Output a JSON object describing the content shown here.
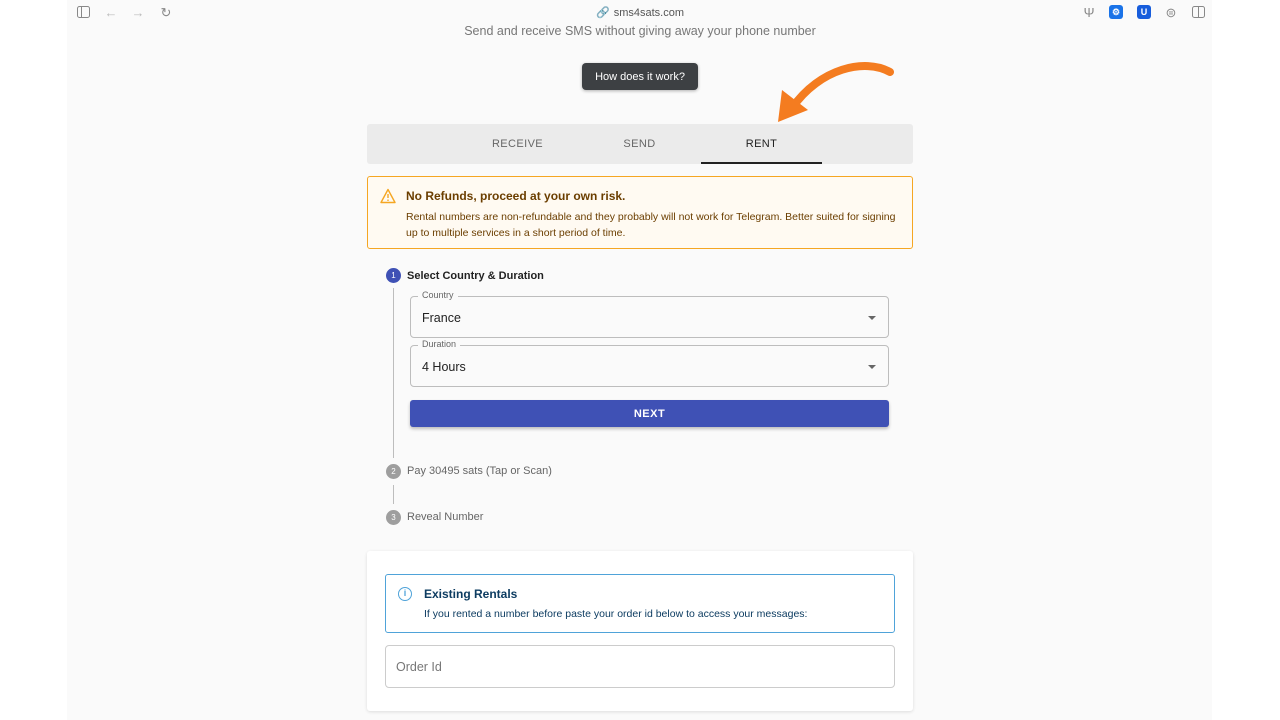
{
  "browser": {
    "url": "sms4sats.com"
  },
  "header": {
    "subtitle": "Send and receive SMS without giving away your phone number",
    "how_button": "How does it work?"
  },
  "tabs": [
    {
      "label": "RECEIVE",
      "active": false
    },
    {
      "label": "SEND",
      "active": false
    },
    {
      "label": "RENT",
      "active": true
    }
  ],
  "warning": {
    "title": "No Refunds, proceed at your own risk.",
    "text": "Rental numbers are non-refundable and they probably will not work for Telegram. Better suited for signing up to multiple services in a short period of time.",
    "color": "#f5a623"
  },
  "steps": [
    {
      "number": "1",
      "label": "Select Country & Duration",
      "active": true
    },
    {
      "number": "2",
      "label": "Pay 30495 sats (Tap or Scan)",
      "active": false
    },
    {
      "number": "3",
      "label": "Reveal Number",
      "active": false
    }
  ],
  "form": {
    "country": {
      "label": "Country",
      "value": "France"
    },
    "duration": {
      "label": "Duration",
      "value": "4 Hours"
    },
    "next_button": "NEXT",
    "accent": "#3f51b5"
  },
  "existing": {
    "title": "Existing Rentals",
    "text": "If you rented a number before paste your order id below to access your messages:",
    "order_placeholder": "Order Id"
  },
  "annotation": {
    "arrow_color": "#f47c20"
  }
}
